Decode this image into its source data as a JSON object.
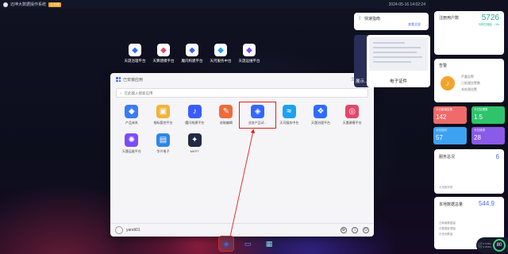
{
  "topbar": {
    "title": "迈坤大数据操作系统",
    "badge": "企业版",
    "clock": "2024-05-16 14:02:24"
  },
  "desktop_icons": [
    {
      "label": "天晟治理平台",
      "icon": "governance-icon",
      "color": "#2f6bff"
    },
    {
      "label": "天算建模平台",
      "icon": "modeling-icon",
      "color": "#e3476a"
    },
    {
      "label": "魔闪构建平台",
      "icon": "build-icon",
      "color": "#3a5cff"
    },
    {
      "label": "天河服务中台",
      "icon": "service-icon",
      "color": "#1ea1f2"
    },
    {
      "label": "天晟运维平台",
      "icon": "ops-icon",
      "color": "#7b4df5"
    }
  ],
  "launcher": {
    "title": "已安装应用",
    "all_apps": "全部应用 >",
    "search_placeholder": "在此输入搜索应用",
    "apps": [
      {
        "label": "产品体系",
        "icon": "product-icon",
        "color": "#3b7cf5",
        "glyph": "◆"
      },
      {
        "label": "指标管控平台",
        "icon": "metric-icon",
        "color": "#f0b43a",
        "glyph": "▣"
      },
      {
        "label": "魔闪构建平台",
        "icon": "build-icon",
        "color": "#3a5cff",
        "glyph": "♪"
      },
      {
        "label": "进取编辑",
        "icon": "editor-icon",
        "color": "#f06a3a",
        "glyph": "✎"
      },
      {
        "label": "业务产品试…",
        "icon": "trial-icon",
        "color": "#3367ff",
        "glyph": "◈"
      },
      {
        "label": "天河服务中台",
        "icon": "service-icon",
        "color": "#1ea1f2",
        "glyph": "≈"
      },
      {
        "label": "天晟治理平台",
        "icon": "governance-icon",
        "color": "#2f6bff",
        "glyph": "❖"
      },
      {
        "label": "天晟建模平台",
        "icon": "modeling-icon",
        "color": "#e3476a",
        "glyph": "◎"
      },
      {
        "label": "天晟运维平台",
        "icon": "ops-icon",
        "color": "#7b4df5",
        "glyph": "✺"
      },
      {
        "label": "华兴电子",
        "icon": "file-icon",
        "color": "#2f86e6",
        "glyph": "▤"
      },
      {
        "label": "MKPT",
        "icon": "mkpt-icon",
        "color": "#222a44",
        "glyph": "✦"
      }
    ],
    "username": "yandi01"
  },
  "quick_start": {
    "title": "快速指南",
    "more": "查看全部"
  },
  "thumbnail": {
    "back_caption": "展示…",
    "caption": "电子证件"
  },
  "stats": {
    "users": {
      "title": "注册用户数",
      "value": "5726",
      "sub": "与昨日相比 ↑ 3%"
    },
    "alerts": {
      "title": "告警",
      "lines": [
        "严重告警",
        "已处理告警数",
        "未处理告警"
      ]
    },
    "tiles": [
      {
        "label": "今日新增告警",
        "value": "142"
      },
      {
        "label": "今日处理数",
        "value": "1.5"
      },
      {
        "label": "今日访问",
        "value": "57"
      },
      {
        "label": "今日请求",
        "value": "28"
      }
    ],
    "services": {
      "title": "服务总况",
      "value": "6",
      "sub": "可用服务数"
    },
    "data": {
      "title": "本地数据总量",
      "value": "544.9",
      "lines": [
        "日新增数据量",
        "日数据处理量",
        "日查询数量"
      ]
    }
  },
  "perf": {
    "value": "80",
    "lines": [
      "上行 0.1KB/s",
      "下行 0.2KB/s"
    ]
  }
}
